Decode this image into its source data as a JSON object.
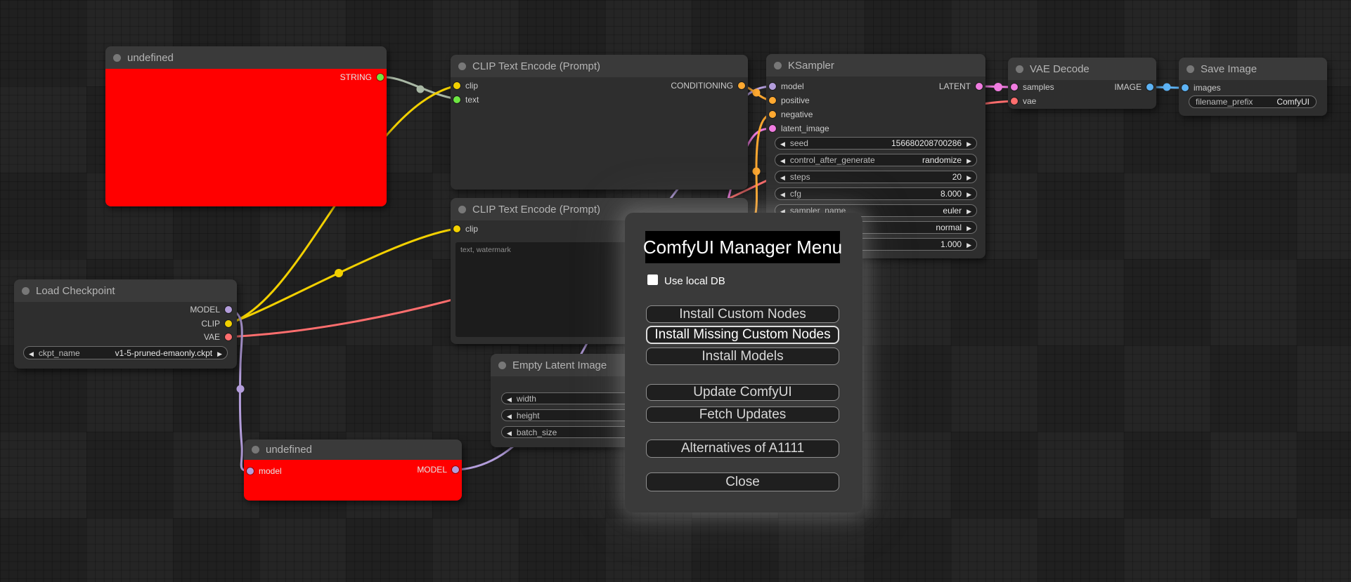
{
  "colors": {
    "clip": "#f2d000",
    "string_wire": "#a9b8a5",
    "green": "#6ee643",
    "conditioning": "#ffa931",
    "model": "#b39ddb",
    "latent": "#f07ce0",
    "vae": "#ff6e6e",
    "image": "#5db3f5",
    "node_red": "#ff0000"
  },
  "dialog": {
    "title": "ComfyUI Manager Menu",
    "checkbox_label": "Use local DB",
    "buttons": [
      {
        "label": "Install Custom Nodes"
      },
      {
        "label": "Install Missing Custom Nodes"
      },
      {
        "label": "Install Models"
      },
      {
        "label": "Update ComfyUI"
      },
      {
        "label": "Fetch Updates"
      },
      {
        "label": "Alternatives of A1111"
      },
      {
        "label": "Close"
      }
    ]
  },
  "nodes": {
    "undefined_top": {
      "title": "undefined",
      "output": "STRING"
    },
    "clip1": {
      "title": "CLIP Text Encode (Prompt)",
      "input_clip": "clip",
      "input_text": "text",
      "output": "CONDITIONING"
    },
    "clip2": {
      "title": "CLIP Text Encode (Prompt)",
      "input_clip": "clip",
      "text_value": "text, watermark"
    },
    "ksampler": {
      "title": "KSampler",
      "input_model": "model",
      "input_positive": "positive",
      "input_negative": "negative",
      "input_latent": "latent_image",
      "output": "LATENT",
      "widgets": [
        {
          "label": "seed",
          "value": "156680208700286"
        },
        {
          "label": "control_after_generate",
          "value": "randomize"
        },
        {
          "label": "steps",
          "value": "20"
        },
        {
          "label": "cfg",
          "value": "8.000"
        },
        {
          "label": "sampler_name",
          "value": "euler"
        },
        {
          "label": "",
          "value": "normal"
        },
        {
          "label": "",
          "value": "1.000"
        }
      ]
    },
    "vae_decode": {
      "title": "VAE Decode",
      "input_samples": "samples",
      "input_vae": "vae",
      "output": "IMAGE"
    },
    "save_image": {
      "title": "Save Image",
      "input_images": "images",
      "widget": {
        "label": "filename_prefix",
        "value": "ComfyUI"
      }
    },
    "load_checkpoint": {
      "title": "Load Checkpoint",
      "out_model": "MODEL",
      "out_clip": "CLIP",
      "out_vae": "VAE",
      "widget": {
        "label": "ckpt_name",
        "value": "v1-5-pruned-emaonly.ckpt"
      }
    },
    "empty_latent": {
      "title": "Empty Latent Image",
      "widgets": [
        {
          "label": "width"
        },
        {
          "label": "height"
        },
        {
          "label": "batch_size"
        }
      ]
    },
    "undefined_bottom": {
      "title": "undefined",
      "input_model": "model",
      "output": "MODEL"
    }
  }
}
